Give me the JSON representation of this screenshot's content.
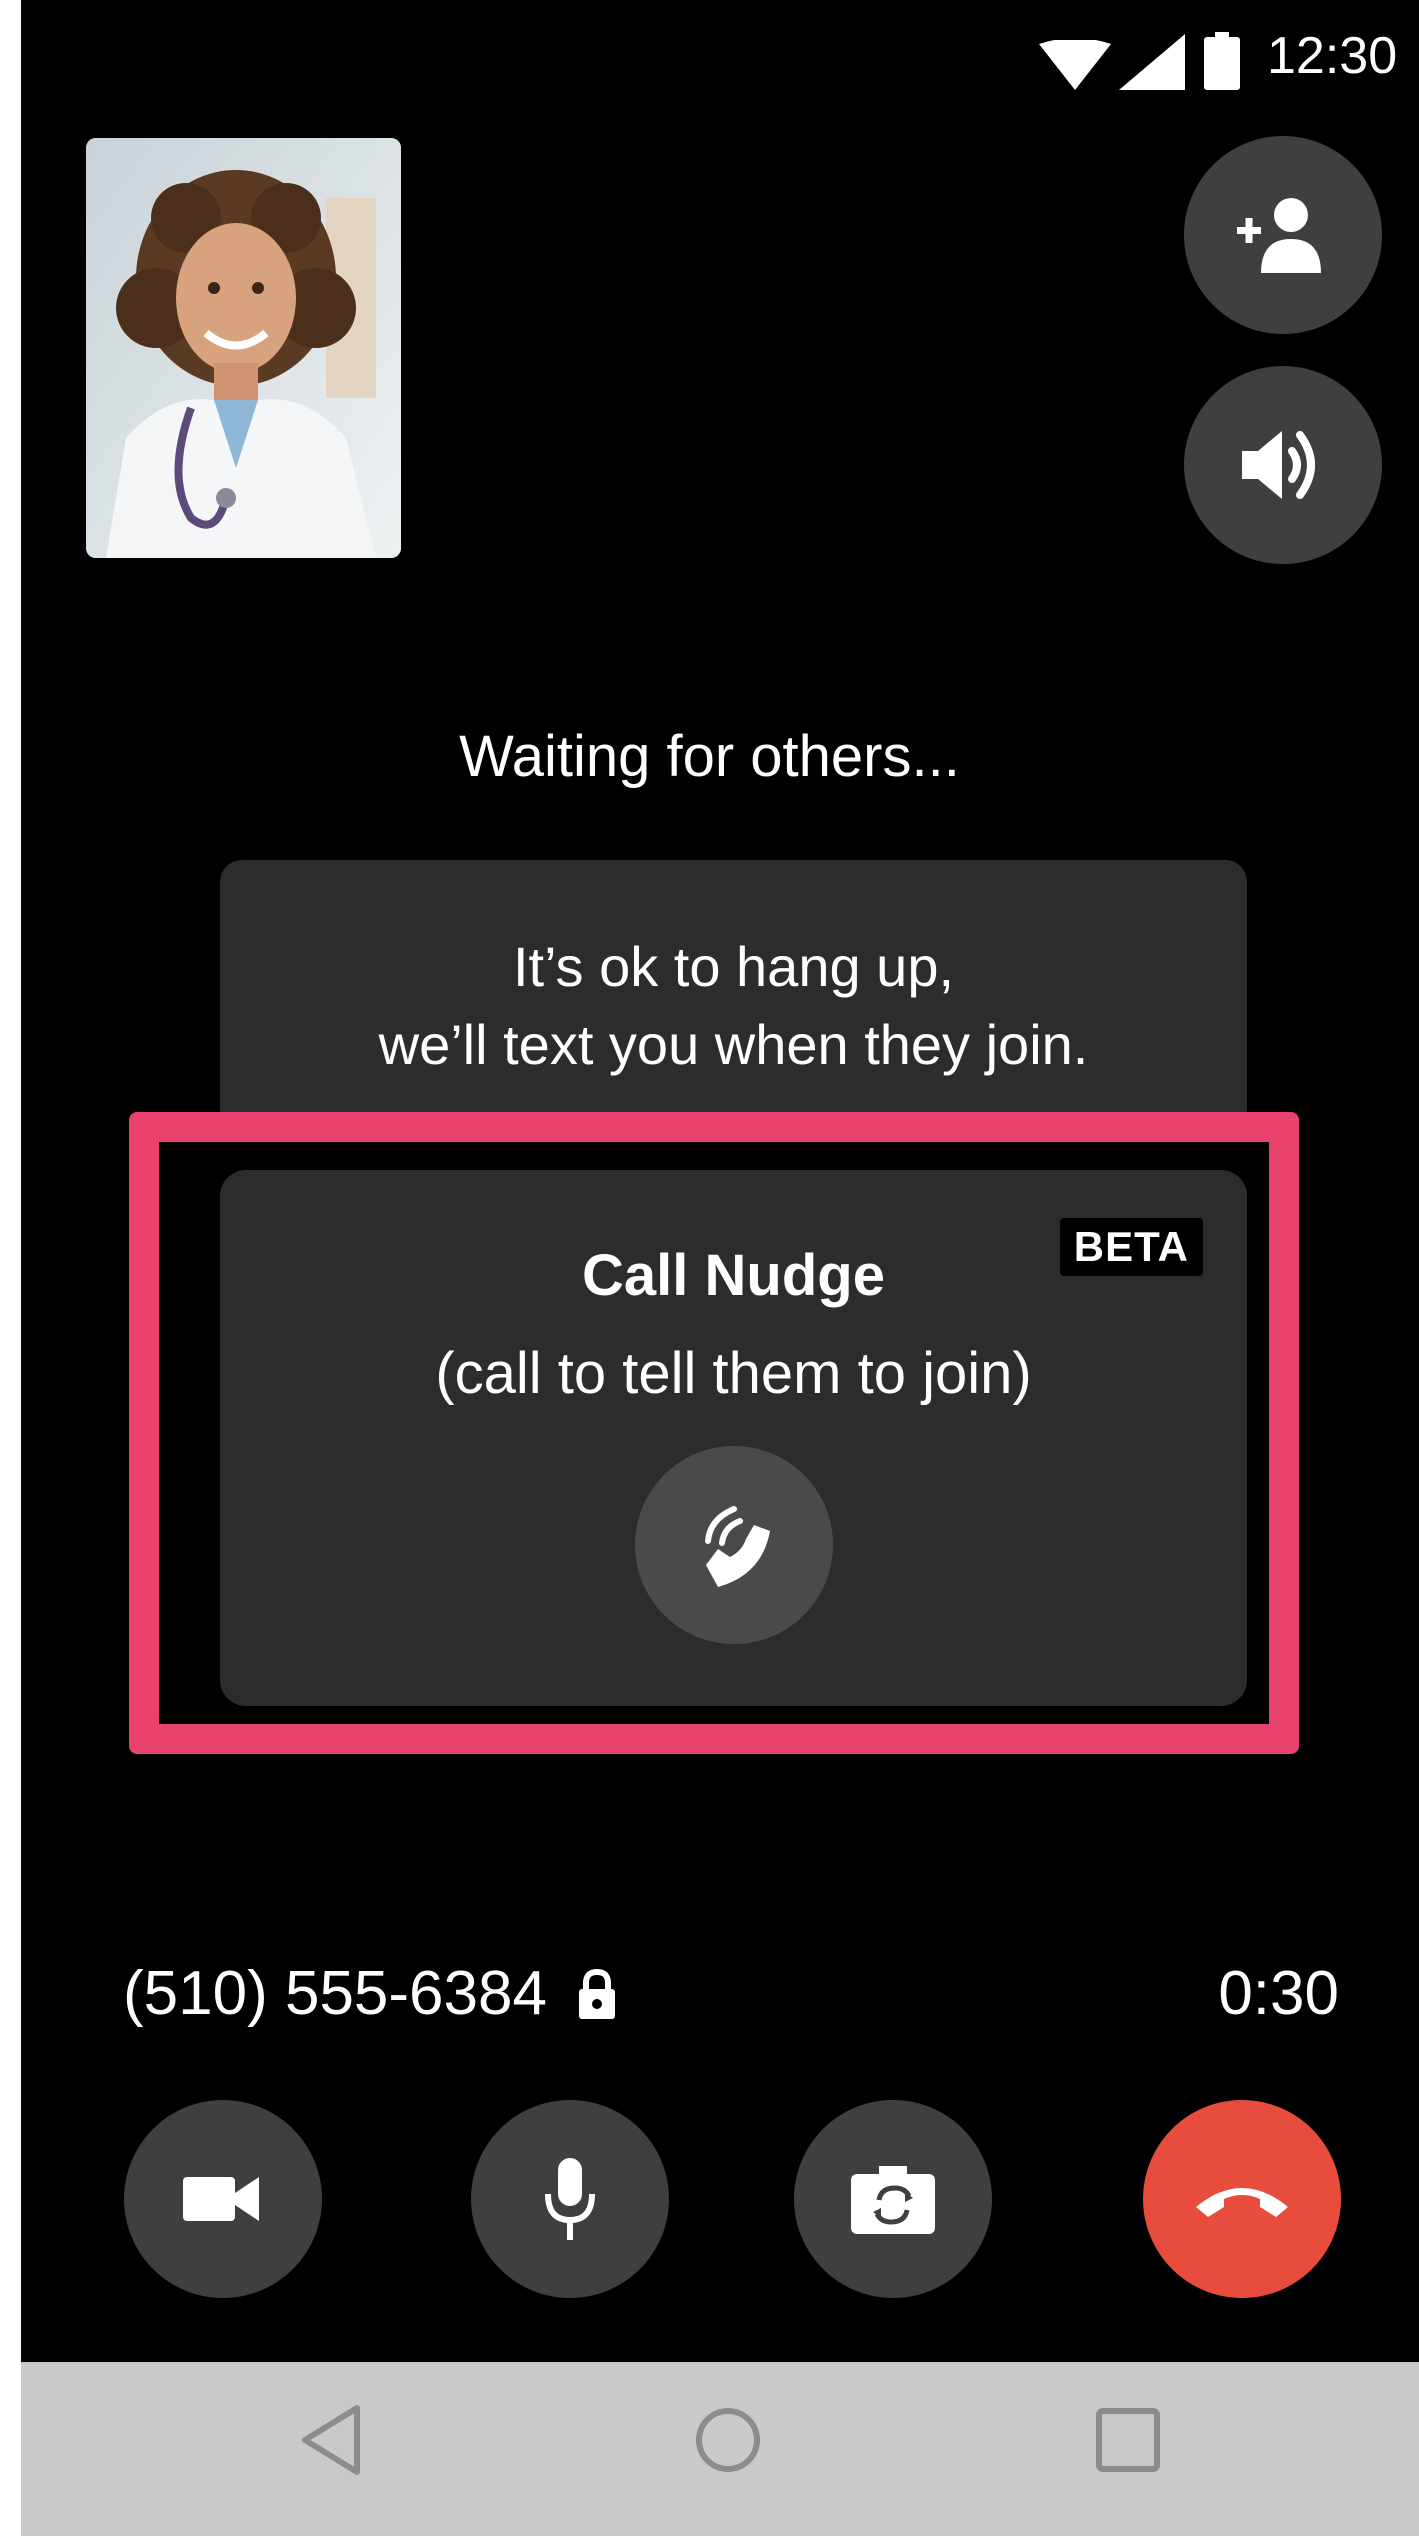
{
  "status_bar": {
    "time": "12:30",
    "icons": [
      "wifi-icon",
      "cell-signal-icon",
      "battery-icon"
    ]
  },
  "self_view": {
    "icon": "doctor-portrait"
  },
  "top_actions": {
    "add_person_icon": "add-person-icon",
    "speaker_icon": "speaker-icon"
  },
  "waiting": {
    "text": "Waiting for others..."
  },
  "hangup_info": {
    "line1": "It’s ok to hang up,",
    "line2": "we’ll text you when they join."
  },
  "call_nudge": {
    "badge": "BETA",
    "title": "Call Nudge",
    "subtitle": "(call to tell them to join)",
    "button_icon": "ringing-phone-icon",
    "highlight_color": "#e9436d"
  },
  "call_info": {
    "phone_number": "(510) 555-6384",
    "lock_icon": "lock-icon",
    "timer": "0:30"
  },
  "controls": {
    "camera_icon": "video-camera-icon",
    "mic_icon": "microphone-icon",
    "flip_icon": "flip-camera-icon",
    "end_call_icon": "end-call-icon",
    "end_call_color": "#e74c3c"
  },
  "nav_bar": {
    "back_icon": "back-triangle-icon",
    "home_icon": "home-circle-icon",
    "recents_icon": "recents-square-icon"
  }
}
